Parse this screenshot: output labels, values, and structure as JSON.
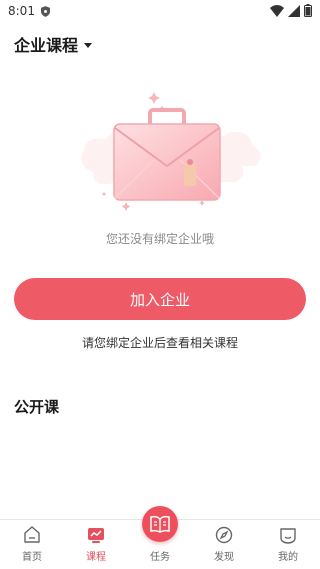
{
  "status": {
    "time": "8:01"
  },
  "header": {
    "title": "企业课程"
  },
  "empty": {
    "message": "您还没有绑定企业哦"
  },
  "join_button": {
    "label": "加入企业"
  },
  "hint": {
    "text": "请您绑定企业后查看相关课程"
  },
  "section": {
    "title": "公开课"
  },
  "tabs": [
    {
      "label": "首页",
      "icon": "home-icon",
      "active": false
    },
    {
      "label": "课程",
      "icon": "course-icon",
      "active": true
    },
    {
      "label": "任务",
      "icon": "book-icon",
      "active": false
    },
    {
      "label": "发现",
      "icon": "compass-icon",
      "active": false
    },
    {
      "label": "我的",
      "icon": "profile-icon",
      "active": false
    }
  ],
  "colors": {
    "accent": "#ee5a66",
    "active_tab": "#e3505e"
  }
}
